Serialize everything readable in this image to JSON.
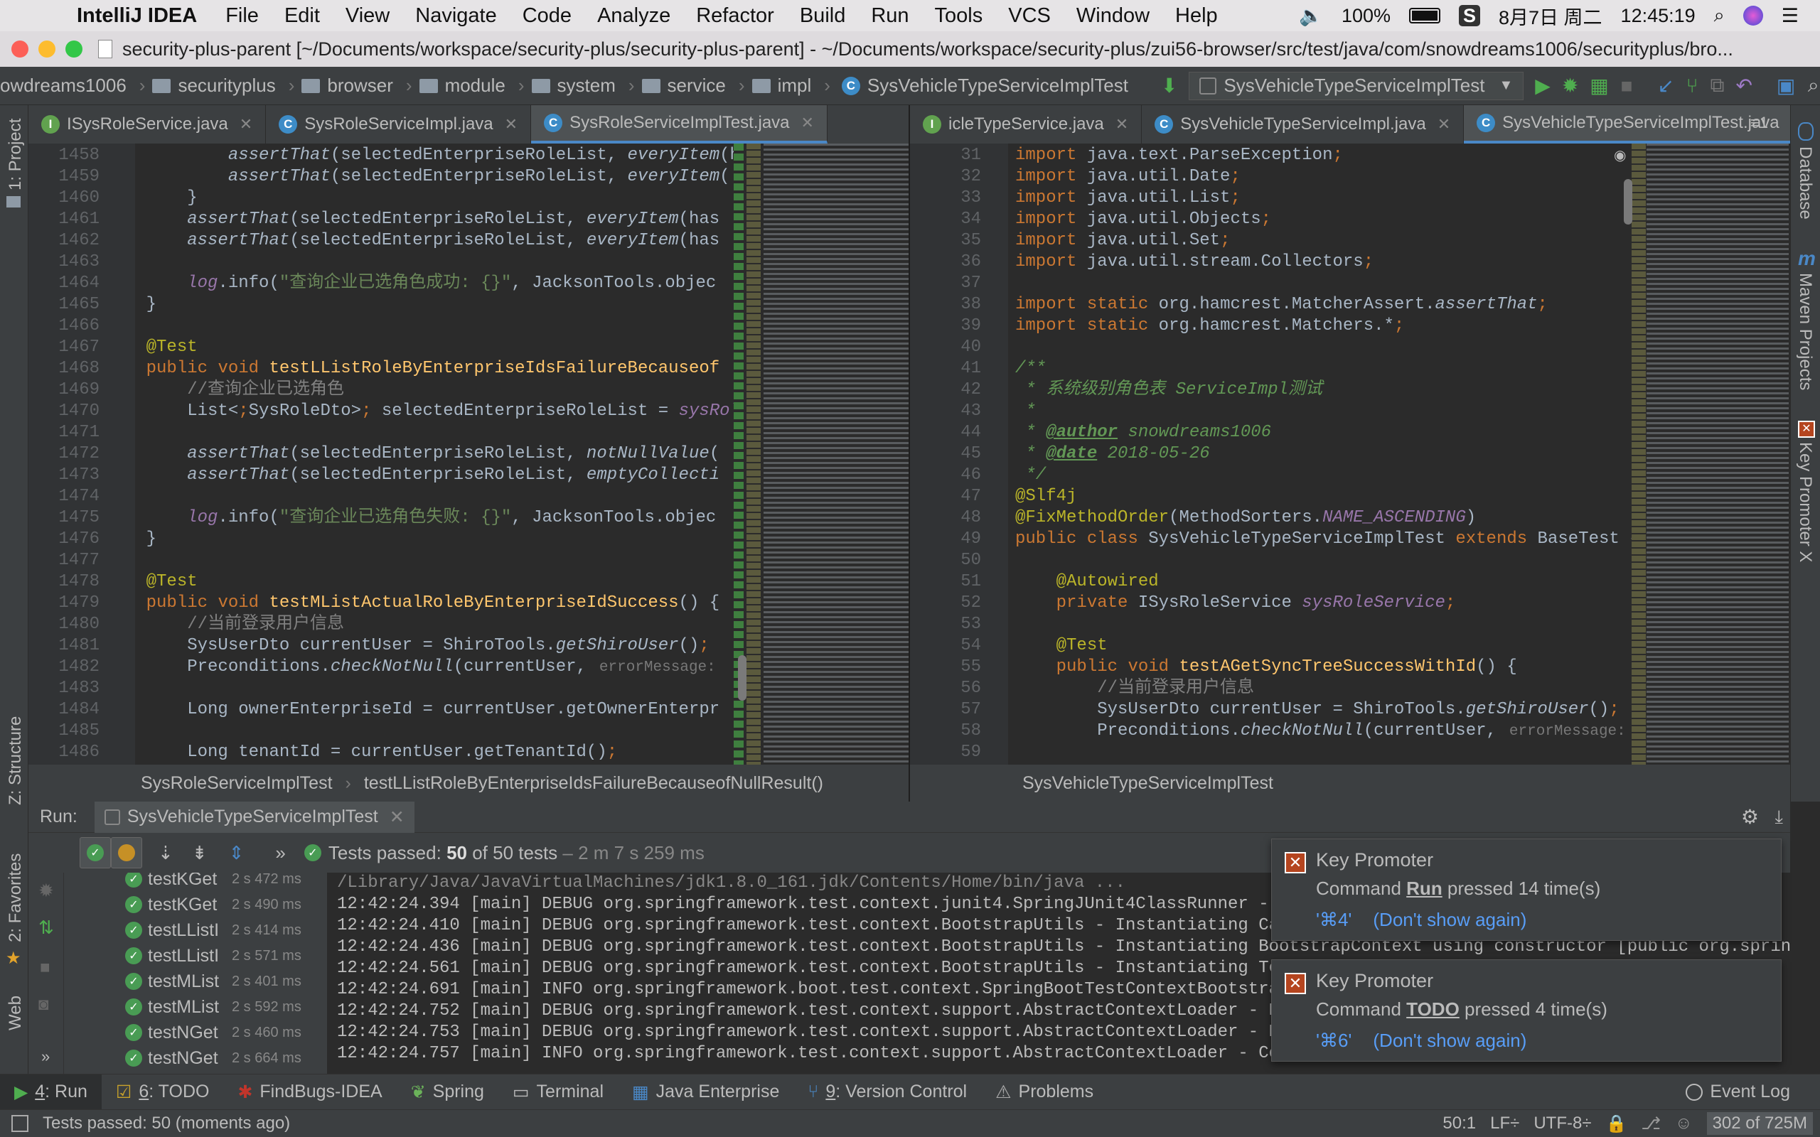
{
  "menubar": {
    "app_name": "IntelliJ IDEA",
    "items": [
      "File",
      "Edit",
      "View",
      "Navigate",
      "Code",
      "Analyze",
      "Refactor",
      "Build",
      "Run",
      "Tools",
      "VCS",
      "Window",
      "Help"
    ],
    "battery": "100%",
    "date": "8月7日 周二",
    "time": "12:45:19"
  },
  "window": {
    "title": "security-plus-parent [~/Documents/workspace/security-plus/security-plus-parent] - ~/Documents/workspace/security-plus/zui56-browser/src/test/java/com/snowdreams1006/securityplus/bro..."
  },
  "navbar": {
    "crumbs": [
      "owdreams1006",
      "securityplus",
      "browser",
      "module",
      "system",
      "service",
      "impl"
    ],
    "class_crumb": "SysVehicleTypeServiceImplTest",
    "run_config": "SysVehicleTypeServiceImplTest"
  },
  "sidebar_left": {
    "project": "1: Project",
    "structure": "Z: Structure",
    "favorites": "2: Favorites",
    "web": "Web"
  },
  "sidebar_right": {
    "database": "Database",
    "maven": "Maven Projects",
    "key_promoter": "Key Promoter X"
  },
  "left_tabs": [
    {
      "label": "ISysRoleService.java",
      "type": "interface"
    },
    {
      "label": "SysRoleServiceImpl.java",
      "type": "class"
    },
    {
      "label": "SysRoleServiceImplTest.java",
      "type": "class"
    }
  ],
  "right_tabs": [
    {
      "label": "icleTypeService.java",
      "type": "interface"
    },
    {
      "label": "SysVehicleTypeServiceImpl.java",
      "type": "class"
    },
    {
      "label": "SysVehicleTypeServiceImplTest.java",
      "type": "class"
    }
  ],
  "right_tabs_overflow": "≡1",
  "left_editor": {
    "lines": [
      {
        "n": "1458",
        "t": "            assertThat(selectedEnterpriseRoleList, everyItem(h"
      },
      {
        "n": "1459",
        "t": "            assertThat(selectedEnterpriseRoleList, everyItem("
      },
      {
        "n": "1460",
        "t": "        }"
      },
      {
        "n": "1461",
        "t": "        assertThat(selectedEnterpriseRoleList, everyItem(has"
      },
      {
        "n": "1462",
        "t": "        assertThat(selectedEnterpriseRoleList, everyItem(has"
      },
      {
        "n": "1463",
        "t": ""
      },
      {
        "n": "1464",
        "t": "        log.info(\"查询企业已选角色成功: {}\", JacksonTools.objec"
      },
      {
        "n": "1465",
        "t": "    }"
      },
      {
        "n": "1466",
        "t": ""
      },
      {
        "n": "1467",
        "t": "    @Test"
      },
      {
        "n": "1468",
        "t": "    public void testLListRoleByEnterpriseIdsFailureBecauseof"
      },
      {
        "n": "1469",
        "t": "        //查询企业已选角色"
      },
      {
        "n": "1470",
        "t": "        List<SysRoleDto> selectedEnterpriseRoleList = sysRol"
      },
      {
        "n": "1471",
        "t": ""
      },
      {
        "n": "1472",
        "t": "        assertThat(selectedEnterpriseRoleList, notNullValue("
      },
      {
        "n": "1473",
        "t": "        assertThat(selectedEnterpriseRoleList, emptyCollecti"
      },
      {
        "n": "1474",
        "t": ""
      },
      {
        "n": "1475",
        "t": "        log.info(\"查询企业已选角色失败: {}\", JacksonTools.objec"
      },
      {
        "n": "1476",
        "t": "    }"
      },
      {
        "n": "1477",
        "t": ""
      },
      {
        "n": "1478",
        "t": "    @Test"
      },
      {
        "n": "1479",
        "t": "    public void testMListActualRoleByEnterpriseIdSuccess() {"
      },
      {
        "n": "1480",
        "t": "        //当前登录用户信息"
      },
      {
        "n": "1481",
        "t": "        SysUserDto currentUser = ShiroTools.getShiroUser();"
      },
      {
        "n": "1482",
        "t": "        Preconditions.checkNotNull(currentUser,"
      },
      {
        "n": "1483",
        "t": ""
      },
      {
        "n": "1484",
        "t": "        Long ownerEnterpriseId = currentUser.getOwnerEnterpr"
      },
      {
        "n": "1485",
        "t": ""
      },
      {
        "n": "1486",
        "t": "        Long tenantId = currentUser.getTenantId();"
      }
    ],
    "hint": "errorMessage:"
  },
  "right_editor": {
    "lines": [
      {
        "n": "31",
        "t": "import java.text.ParseException;"
      },
      {
        "n": "32",
        "t": "import java.util.Date;"
      },
      {
        "n": "33",
        "t": "import java.util.List;"
      },
      {
        "n": "34",
        "t": "import java.util.Objects;"
      },
      {
        "n": "35",
        "t": "import java.util.Set;"
      },
      {
        "n": "36",
        "t": "import java.util.stream.Collectors;"
      },
      {
        "n": "37",
        "t": ""
      },
      {
        "n": "38",
        "t": "import static org.hamcrest.MatcherAssert.assertThat;"
      },
      {
        "n": "39",
        "t": "import static org.hamcrest.Matchers.*;"
      },
      {
        "n": "40",
        "t": ""
      },
      {
        "n": "41",
        "t": "/**"
      },
      {
        "n": "42",
        "t": " * 系统级别角色表 ServiceImpl测试"
      },
      {
        "n": "43",
        "t": " *"
      },
      {
        "n": "44",
        "t": " * @author snowdreams1006"
      },
      {
        "n": "45",
        "t": " * @date 2018-05-26"
      },
      {
        "n": "46",
        "t": " */"
      },
      {
        "n": "47",
        "t": "@Slf4j"
      },
      {
        "n": "48",
        "t": "@FixMethodOrder(MethodSorters.NAME_ASCENDING)"
      },
      {
        "n": "49",
        "t": "public class SysVehicleTypeServiceImplTest extends BaseTest {"
      },
      {
        "n": "50",
        "t": ""
      },
      {
        "n": "51",
        "t": "    @Autowired"
      },
      {
        "n": "52",
        "t": "    private ISysRoleService sysRoleService;"
      },
      {
        "n": "53",
        "t": ""
      },
      {
        "n": "54",
        "t": "    @Test"
      },
      {
        "n": "55",
        "t": "    public void testAGetSyncTreeSuccessWithId() {"
      },
      {
        "n": "56",
        "t": "        //当前登录用户信息"
      },
      {
        "n": "57",
        "t": "        SysUserDto currentUser = ShiroTools.getShiroUser();"
      },
      {
        "n": "58",
        "t": "        Preconditions.checkNotNull(currentUser,"
      },
      {
        "n": "59",
        "t": ""
      }
    ],
    "hint": "errorMessage:"
  },
  "left_breadcrumb": {
    "cls": "SysRoleServiceImplTest",
    "method": "testLListRoleByEnterpriseIdsFailureBecauseofNullResult()"
  },
  "right_breadcrumb": {
    "cls": "SysVehicleTypeServiceImplTest"
  },
  "run_panel": {
    "label": "Run:",
    "config": "SysVehicleTypeServiceImplTest",
    "status": "Tests passed: ",
    "passed": "50",
    "of_text": " of 50 tests",
    "duration": " – 2 m 7 s 259 ms",
    "tests": [
      {
        "name": "testKGet",
        "time": "2 s 472 ms"
      },
      {
        "name": "testKGet",
        "time": "2 s 490 ms"
      },
      {
        "name": "testLListI",
        "time": "2 s 414 ms"
      },
      {
        "name": "testLListI",
        "time": "2 s 571 ms"
      },
      {
        "name": "testMList",
        "time": "2 s 401 ms"
      },
      {
        "name": "testMList",
        "time": "2 s 592 ms"
      },
      {
        "name": "testNGet",
        "time": "2 s 460 ms"
      },
      {
        "name": "testNGet",
        "time": "2 s 664 ms"
      }
    ],
    "console": [
      "/Library/Java/JavaVirtualMachines/jdk1.8.0_161.jdk/Contents/Home/bin/java ...",
      "12:42:24.394 [main] DEBUG org.springframework.test.context.junit4.SpringJUnit4ClassRunner - Sp",
      "12:42:24.410 [main] DEBUG org.springframework.test.context.BootstrapUtils - Instantiating Cach",
      "12:42:24.436 [main] DEBUG org.springframework.test.context.BootstrapUtils - Instantiating BootstrapContext using constructor [public org.sprin",
      "12:42:24.561 [main] DEBUG org.springframework.test.context.BootstrapUtils - Instantiating Test",
      "12:42:24.691 [main] INFO org.springframework.boot.test.context.SpringBootTestContextBootstrapp",
      "12:42:24.752 [main] DEBUG org.springframework.test.context.support.AbstractContextLoader - Dic",
      "12:42:24.753 [main] DEBUG org.springframework.test.context.support.AbstractContextLoader - Dic",
      "12:42:24.757 [main] INFO org.springframework.test.context.support.AbstractContextLoader - Could not detect default resource locations for tes"
    ]
  },
  "popups": [
    {
      "title": "Key Promoter",
      "prefix": "Command ",
      "cmd": "Run",
      "suffix": " pressed 14 time(s)",
      "shortcut": "'⌘4'",
      "dismiss": "(Don't show again)"
    },
    {
      "title": "Key Promoter",
      "prefix": "Command ",
      "cmd": "TODO",
      "suffix": " pressed 4 time(s)",
      "shortcut": "'⌘6'",
      "dismiss": "(Don't show again)"
    }
  ],
  "bottom_tabs": [
    {
      "num": "4",
      "label": ": Run",
      "icon": "play-icon"
    },
    {
      "num": "6",
      "label": ": TODO",
      "icon": "todo-icon"
    },
    {
      "num": "",
      "label": "FindBugs-IDEA",
      "icon": "bug-icon"
    },
    {
      "num": "",
      "label": "Spring",
      "icon": "spring-leaf-icon"
    },
    {
      "num": "",
      "label": "Terminal",
      "icon": "terminal-icon"
    },
    {
      "num": "",
      "label": "Java Enterprise",
      "icon": "java-enterprise-icon"
    },
    {
      "num": "9",
      "label": ": Version Control",
      "icon": "vcs-icon"
    },
    {
      "num": "",
      "label": "Problems",
      "icon": "warning-icon"
    }
  ],
  "event_log": "Event Log",
  "status": {
    "message": "Tests passed: 50 (moments ago)",
    "position": "50:1",
    "line_sep": "LF÷",
    "encoding": "UTF-8÷",
    "memory": "302 of 725M"
  },
  "colors": {
    "accent": "#4a88c7",
    "pass": "#499c54",
    "keyword": "#cc7832",
    "annotation": "#bbb529",
    "string": "#6a8759",
    "link": "#589df6"
  }
}
